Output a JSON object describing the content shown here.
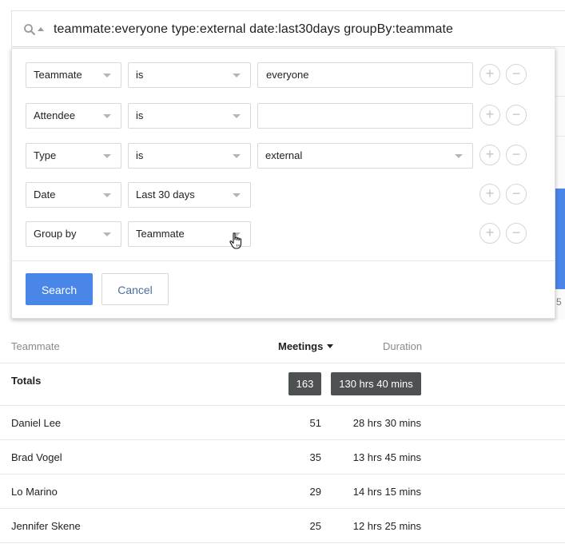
{
  "search": {
    "query": "teammate:everyone type:external date:last30days groupBy:teammate"
  },
  "filters": [
    {
      "field": "Teammate",
      "operator": "is",
      "value": "everyone",
      "value_kind": "text"
    },
    {
      "field": "Attendee",
      "operator": "is",
      "value": "",
      "value_kind": "text"
    },
    {
      "field": "Type",
      "operator": "is",
      "value": "external",
      "value_kind": "select"
    },
    {
      "field": "Date",
      "operator": "Last 30 days",
      "value": null,
      "value_kind": "none"
    },
    {
      "field": "Group by",
      "operator": "Teammate",
      "value": null,
      "value_kind": "none"
    }
  ],
  "row_controls": {
    "add": "+",
    "remove": "−"
  },
  "actions": {
    "search_label": "Search",
    "cancel_label": "Cancel"
  },
  "background": {
    "tick_label": "5"
  },
  "table": {
    "headers": {
      "teammate": "Teammate",
      "meetings": "Meetings",
      "duration": "Duration"
    },
    "totals": {
      "label": "Totals",
      "meetings": "163",
      "duration": "130 hrs 40 mins"
    },
    "rows": [
      {
        "name": "Daniel Lee",
        "meetings": "51",
        "duration": "28 hrs 30 mins"
      },
      {
        "name": "Brad Vogel",
        "meetings": "35",
        "duration": "13 hrs 45 mins"
      },
      {
        "name": "Lo Marino",
        "meetings": "29",
        "duration": "14 hrs 15 mins"
      },
      {
        "name": "Jennifer Skene",
        "meetings": "25",
        "duration": "12 hrs 25 mins"
      }
    ]
  },
  "colors": {
    "primary": "#4a86e8",
    "badge": "#4d5152",
    "cancel_text": "#4a6e9a"
  }
}
